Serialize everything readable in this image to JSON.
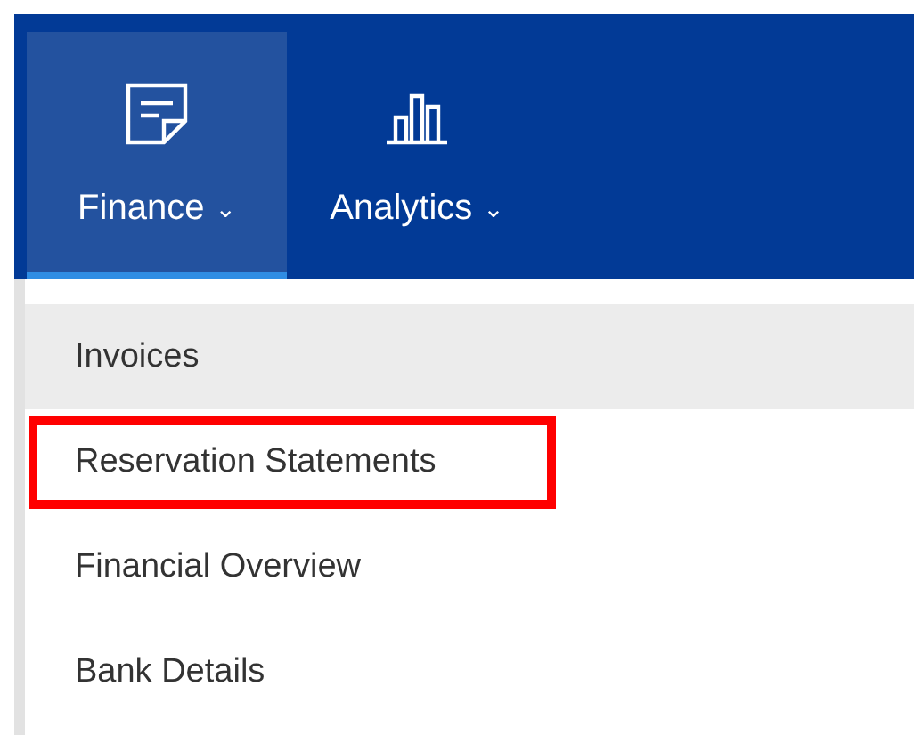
{
  "nav_tabs": [
    {
      "label": "Finance",
      "kind": "note",
      "selected": true,
      "caret": "⌄"
    },
    {
      "label": "Analytics",
      "kind": "chart",
      "selected": false,
      "caret": "⌄"
    }
  ],
  "menu_items": [
    {
      "label": "Invoices",
      "hovered": true,
      "highlighted": false
    },
    {
      "label": "Reservation Statements",
      "hovered": false,
      "highlighted": true
    },
    {
      "label": "Financial Overview",
      "hovered": false,
      "highlighted": false
    },
    {
      "label": "Bank Details",
      "hovered": false,
      "highlighted": false
    }
  ]
}
